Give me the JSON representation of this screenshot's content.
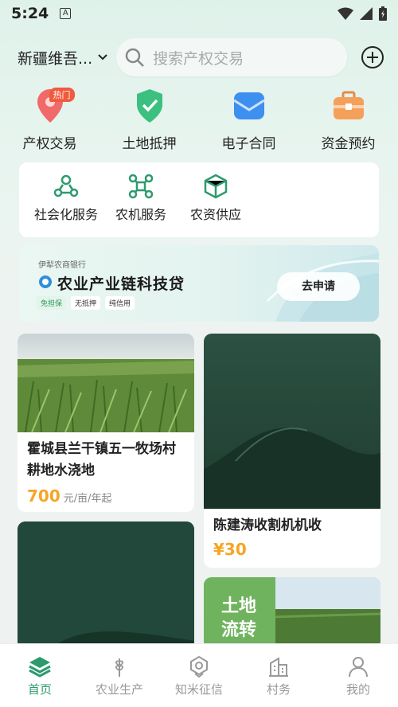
{
  "status": {
    "time": "5:24",
    "app_glyph": "A"
  },
  "header": {
    "location": "新疆维吾...",
    "search_placeholder": "搜索产权交易"
  },
  "quick_actions": [
    {
      "label": "产权交易",
      "badge": "热门",
      "icon": "location-pin-icon"
    },
    {
      "label": "土地抵押",
      "icon": "shield-check-icon"
    },
    {
      "label": "电子合同",
      "icon": "envelope-icon"
    },
    {
      "label": "资金预约",
      "icon": "briefcase-icon"
    }
  ],
  "services": [
    {
      "label": "社会化服务",
      "icon": "people-network-icon"
    },
    {
      "label": "农机服务",
      "icon": "drone-icon"
    },
    {
      "label": "农资供应",
      "icon": "package-icon"
    }
  ],
  "banner": {
    "bank": "伊犁农商银行",
    "title": "农业产业链科技贷",
    "tags": [
      "免担保",
      "无抵押",
      "纯信用"
    ],
    "button": "去申请"
  },
  "feed": [
    {
      "title": "霍城县兰干镇五一牧场村耕地水浇地",
      "price": "700",
      "unit": "元/亩/年起"
    },
    {
      "title": "陈建涛收割机机收",
      "price": "¥30"
    },
    {
      "overlay_text": "土地流转"
    }
  ],
  "tabs": [
    {
      "label": "首页",
      "icon": "layers-icon",
      "active": true
    },
    {
      "label": "农业生产",
      "icon": "wheat-icon"
    },
    {
      "label": "知米征信",
      "icon": "credit-badge-icon"
    },
    {
      "label": "村务",
      "icon": "building-icon"
    },
    {
      "label": "我的",
      "icon": "person-icon"
    }
  ],
  "colors": {
    "accent": "#2d9a6e",
    "price": "#f5a623",
    "hot": "#f15a3e"
  }
}
